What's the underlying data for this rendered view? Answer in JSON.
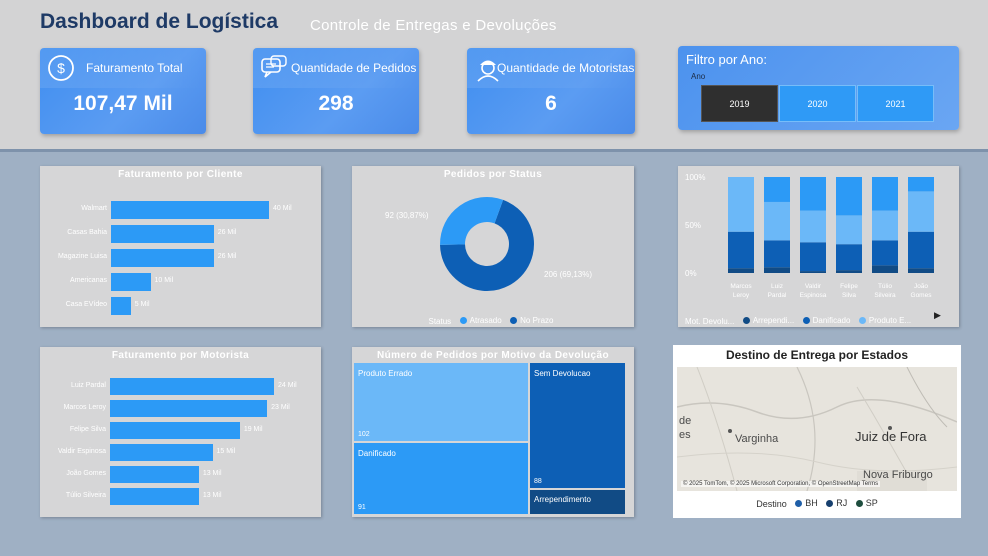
{
  "header": {
    "title": "Dashboard de Logística",
    "subtitle": "Controle de Entregas e Devoluções"
  },
  "kpis": [
    {
      "label": "Faturamento Total",
      "value": "107,47 Mil",
      "icon": "dollar-circle-icon"
    },
    {
      "label": "Quantidade de Pedidos",
      "value": "298",
      "icon": "chat-bubbles-icon"
    },
    {
      "label": "Quantidade de Motoristas",
      "value": "6",
      "icon": "driver-icon"
    }
  ],
  "filter": {
    "title": "Filtro por Ano:",
    "field": "Ano",
    "years": [
      "2019",
      "2020",
      "2021"
    ],
    "selected": "2019"
  },
  "colors": {
    "bar": "#2c9af6",
    "dark_blue": "#0d5fb5",
    "mid_blue": "#2c9af6",
    "light_blue": "#6bb8f8",
    "navy": "#114b85"
  },
  "faturamento_cliente": {
    "title": "Faturamento por Cliente",
    "chart_data": {
      "type": "bar",
      "orientation": "horizontal",
      "categories": [
        "Walmart",
        "Casas Bahia",
        "Magazine Luisa",
        "Americanas",
        "Casa EVídeo"
      ],
      "values": [
        40,
        26,
        26,
        10,
        5
      ],
      "labels": [
        "40 Mil",
        "26 Mil",
        "26 Mil",
        "10 Mil",
        "5 Mil"
      ]
    }
  },
  "pedidos_status": {
    "title": "Pedidos por Status",
    "chart_data": {
      "type": "pie",
      "donut": true,
      "categories": [
        "Atrasado",
        "No Prazo"
      ],
      "values": [
        92,
        206
      ],
      "labels": [
        "92 (30,87%)",
        "206 (69,13%)"
      ],
      "colors": [
        "#2c9af6",
        "#0d5fb5"
      ]
    },
    "legend_title": "Status",
    "legend": [
      "Atrasado",
      "No Prazo"
    ]
  },
  "devolucao_stacked": {
    "chart_data": {
      "type": "bar",
      "stacked": true,
      "percent": true,
      "categories": [
        "Marcos Leroy",
        "Luiz Pardal",
        "Valdir Espinosa",
        "Felipe Silva",
        "Túlio Silveira",
        "João Gomes"
      ],
      "category_lines": [
        [
          "Marcos",
          "Leroy"
        ],
        [
          "Luiz",
          "Pardal"
        ],
        [
          "Valdir",
          "Espinosa"
        ],
        [
          "Felipe",
          "Silva"
        ],
        [
          "Túlio",
          "Silveira"
        ],
        [
          "João",
          "Gomes"
        ]
      ],
      "series": [
        {
          "name": "Arrependimento",
          "values": [
            5,
            6,
            2,
            3,
            8,
            5
          ]
        },
        {
          "name": "Danificado",
          "values": [
            38,
            28,
            30,
            27,
            26,
            38
          ]
        },
        {
          "name": "Produto Errado",
          "values": [
            57,
            40,
            33,
            30,
            31,
            42
          ]
        },
        {
          "name": "Sem Devolucao",
          "values": [
            0,
            26,
            35,
            40,
            35,
            15
          ]
        }
      ],
      "y_ticks": [
        "0%",
        "50%",
        "100%"
      ]
    },
    "legend_title": "Mot. Devolu...",
    "legend": [
      "Arrependi...",
      "Danificado",
      "Produto E..."
    ]
  },
  "faturamento_motorista": {
    "title": "Faturamento por Motorista",
    "chart_data": {
      "type": "bar",
      "orientation": "horizontal",
      "categories": [
        "Luiz Pardal",
        "Marcos Leroy",
        "Felipe Silva",
        "Valdir Espinosa",
        "João Gomes",
        "Túlio Silveira"
      ],
      "values": [
        24,
        23,
        19,
        15,
        13,
        13
      ],
      "labels": [
        "24 Mil",
        "23 Mil",
        "19 Mil",
        "15 Mil",
        "13 Mil",
        "13 Mil"
      ]
    }
  },
  "treemap": {
    "title": "Número de Pedidos por Motivo da Devolução",
    "chart_data": {
      "type": "treemap",
      "categories": [
        "Produto Errado",
        "Danificado",
        "Sem Devolucao",
        "Arrependimento"
      ],
      "values": [
        102,
        91,
        88,
        17
      ],
      "labels": [
        "102",
        "91",
        "88",
        ""
      ]
    }
  },
  "map": {
    "title": "Destino de Entrega por Estados",
    "cities": [
      "Varginha",
      "Juiz de Fora",
      "Nova Friburgo",
      "de",
      "es"
    ],
    "credit": "© 2025 TomTom, © 2025 Microsoft Corporation, © OpenStreetMap Terms",
    "legend_title": "Destino",
    "legend": [
      "BH",
      "RJ",
      "SP"
    ]
  }
}
